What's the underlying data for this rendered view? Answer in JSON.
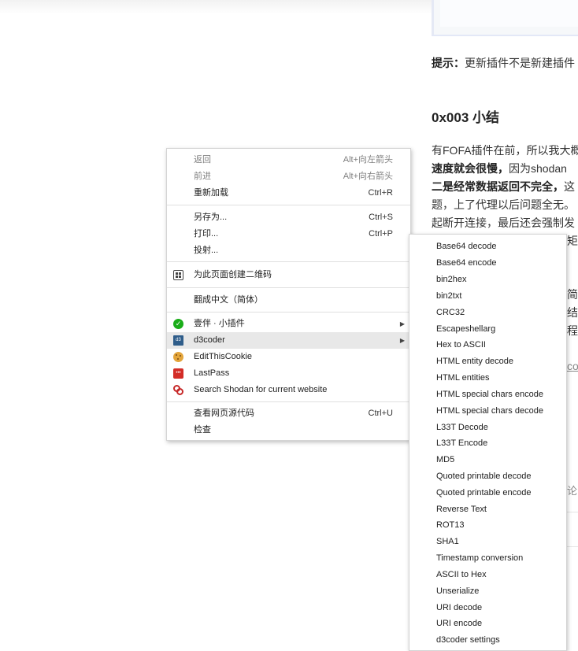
{
  "article": {
    "tip_label": "提示：",
    "tip_text": "更新插件不是新建插件",
    "section_heading": "0x003 小结",
    "p1_line1": "有FOFA插件在前，所以我大概",
    "p1_line2_bold": "速度就会很慢，",
    "p1_line2_rest": "因为shodan",
    "p1_line3_bold": "二是经常数据返回不完全，",
    "p1_line3_rest": "这",
    "p1_line4": "题，上了代理以后问题全无。",
    "p1_line5": "起断开连接，最后还会强制发",
    "p1_line6": "矩",
    "p2_line1": "简",
    "p2_line2": "结合",
    "p2_line3": "程",
    "link_frag": "co",
    "comment_frag": "论"
  },
  "context_menu": {
    "items": [
      {
        "label": "返回",
        "shortcut": "Alt+向左箭头",
        "disabled": true
      },
      {
        "label": "前进",
        "shortcut": "Alt+向右箭头",
        "disabled": true
      },
      {
        "label": "重新加载",
        "shortcut": "Ctrl+R"
      },
      {
        "label": "另存为...",
        "shortcut": "Ctrl+S"
      },
      {
        "label": "打印...",
        "shortcut": "Ctrl+P"
      },
      {
        "label": "投射..."
      },
      {
        "label": "为此页面创建二维码",
        "icon": "qr-code-icon"
      },
      {
        "label": "翻成中文（简体）"
      },
      {
        "label": "壹伴 · 小插件",
        "icon": "yiban-icon",
        "submenu": true
      },
      {
        "label": "d3coder",
        "icon": "d3coder-icon",
        "submenu": true
      },
      {
        "label": "EditThisCookie",
        "icon": "cookie-icon"
      },
      {
        "label": "LastPass",
        "icon": "lastpass-icon"
      },
      {
        "label": "Search Shodan for current website",
        "icon": "shodan-icon"
      },
      {
        "label": "查看网页源代码",
        "shortcut": "Ctrl+U"
      },
      {
        "label": "检查"
      }
    ]
  },
  "submenu": {
    "items": [
      "Base64 decode",
      "Base64 encode",
      "bin2hex",
      "bin2txt",
      "CRC32",
      "Escapeshellarg",
      "Hex to ASCII",
      "HTML entity decode",
      "HTML entities",
      "HTML special chars encode",
      "HTML special chars decode",
      "L33T Decode",
      "L33T Encode",
      "MD5",
      "Quoted printable decode",
      "Quoted printable encode",
      "Reverse Text",
      "ROT13",
      "SHA1",
      "Timestamp conversion",
      "ASCII to Hex",
      "Unserialize",
      "URI decode",
      "URI encode",
      "d3coder settings"
    ]
  },
  "icon_glyphs": {
    "yiban": "✓",
    "d3coder": "d3",
    "lastpass": "•••",
    "submenu_arrow": "▶"
  }
}
